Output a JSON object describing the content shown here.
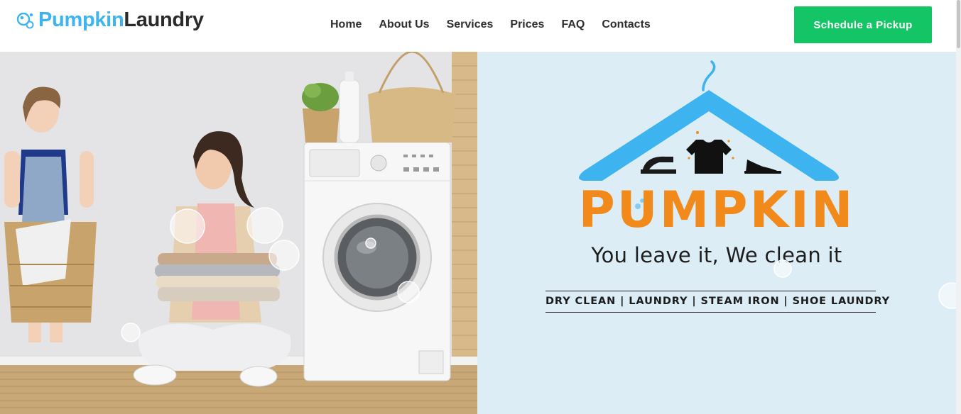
{
  "brand": {
    "name_part1": "Pumpkin",
    "name_part2": "Laundry"
  },
  "nav": {
    "items": [
      {
        "label": "Home"
      },
      {
        "label": "About Us"
      },
      {
        "label": "Services"
      },
      {
        "label": "Prices"
      },
      {
        "label": "FAQ"
      },
      {
        "label": "Contacts"
      }
    ]
  },
  "cta": {
    "label": "Schedule a Pickup"
  },
  "hero": {
    "wordmark": "PUMPKIN",
    "tagline": "You leave it, We clean it",
    "services_line": "DRY CLEAN | LAUNDRY | STEAM IRON | SHOE LAUNDRY"
  },
  "colors": {
    "brand_blue": "#3db4ef",
    "brand_orange": "#f28a1b",
    "cta_green": "#13c565",
    "panel_bg": "#dcedf5"
  },
  "icons": [
    "bubbles-logo-icon",
    "hanger-icon",
    "iron-icon",
    "tshirt-icon",
    "shoe-icon"
  ]
}
